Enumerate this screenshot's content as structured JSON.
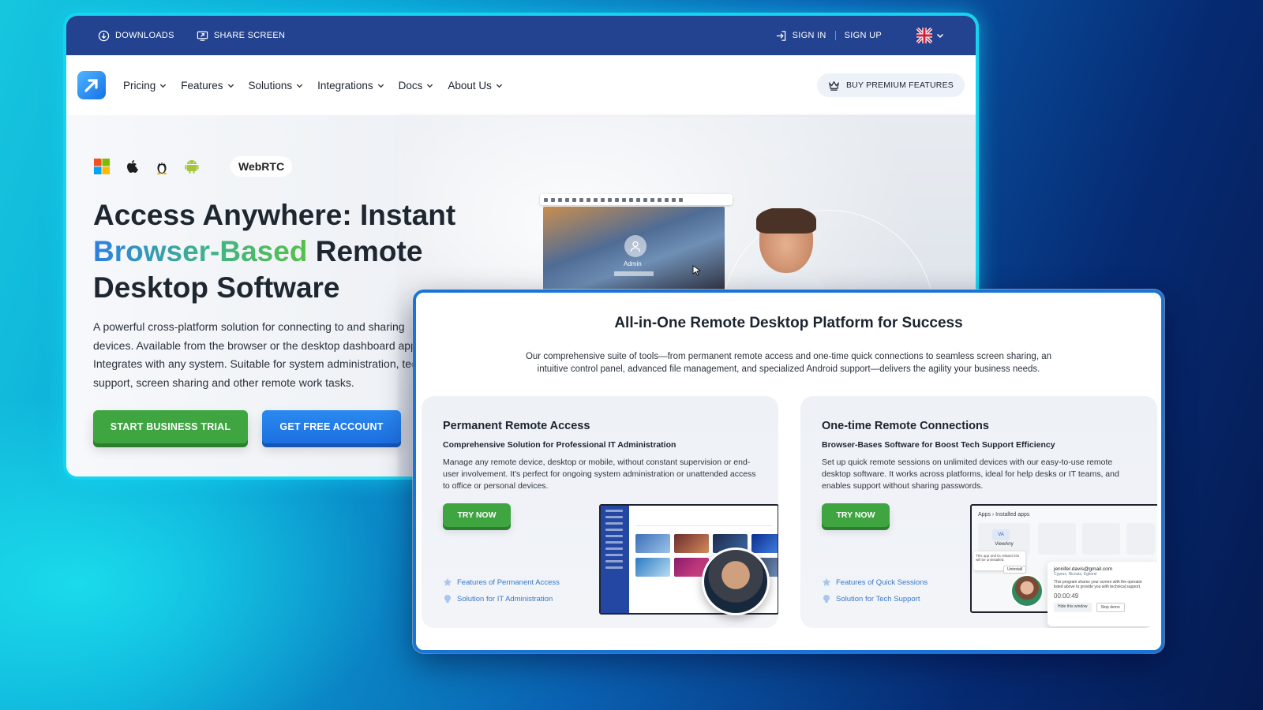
{
  "topbar": {
    "downloads": "DOWNLOADS",
    "share_screen": "SHARE SCREEN",
    "sign_in": "SIGN IN",
    "sign_up": "SIGN UP"
  },
  "nav": {
    "items": [
      "Pricing",
      "Features",
      "Solutions",
      "Integrations",
      "Docs",
      "About Us"
    ],
    "premium": "BUY PREMIUM FEATURES"
  },
  "hero": {
    "os_icons": [
      "windows-icon",
      "apple-icon",
      "linux-icon",
      "android-icon"
    ],
    "webrtc": "WebRTC",
    "title_line1": "Access Anywhere: Instant",
    "title_highlight": "Browser-Based",
    "title_rest": " Remote",
    "title_line3": "Desktop Software",
    "desc_lines": [
      "A powerful cross-platform solution for connecting to and sharing",
      "devices. Available from the browser or the desktop dashboard app.",
      "Integrates with any system. Suitable for system administration, tech",
      "support, screen sharing and other remote work tasks."
    ],
    "btn_trial": "START BUSINESS TRIAL",
    "btn_free": "GET FREE ACCOUNT",
    "mock_admin": "Admin"
  },
  "platform": {
    "title": "All-in-One Remote Desktop Platform for Success",
    "subtitle": "Our comprehensive suite of tools—from permanent remote access and one-time quick connections to seamless screen sharing, an intuitive control panel, advanced file management, and specialized Android support—delivers the agility your business needs.",
    "cards": [
      {
        "title": "Permanent Remote Access",
        "subtitle": "Comprehensive Solution for Professional IT Administration",
        "desc": "Manage any remote device, desktop or mobile, without constant supervision or end-user involvement. It's perfect for ongoing system administration or unattended access to office or personal devices.",
        "button": "TRY NOW",
        "link1": "Features of Permanent Access",
        "link2": "Solution for IT Administration"
      },
      {
        "title": "One-time Remote Connections",
        "subtitle": "Browser-Bases Software for Boost Tech Support Efficiency",
        "desc": "Set up quick remote sessions on unlimited devices with our easy-to-use remote desktop software. It works across platforms, ideal for help desks or IT teams, and enables support without sharing passwords.",
        "button": "TRY NOW",
        "link1": "Features of Quick Sessions",
        "link2": "Solution for Tech Support"
      }
    ],
    "apps_mock": {
      "crumb": "Apps  ›  Installed apps",
      "app_name": "ViewAny",
      "uninstall_note": "This app and its related info will be uninstalled.",
      "uninstall": "Uninstall",
      "email": "jennifer.davis@gmail.com",
      "location": "Cyprus, Nicosia, Egkomi",
      "note": "This program shares your screen with the operator listed above to provide you with technical support.",
      "timer": "00:00:49",
      "hide": "Hide this window",
      "stop": "Stop demo"
    }
  },
  "colors": {
    "topbar": "#234391",
    "green": "#3ea541",
    "blue": "#1c6fe0",
    "frame_glow": "#16d3ef"
  }
}
